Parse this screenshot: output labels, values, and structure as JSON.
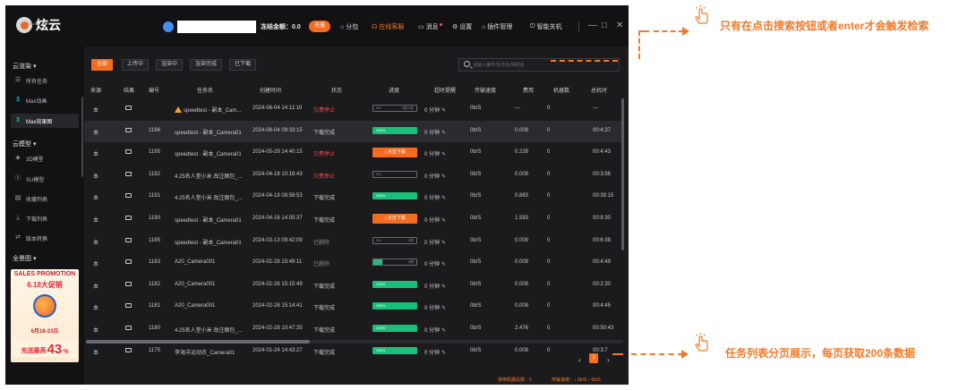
{
  "header": {
    "logo_text": "炫云",
    "logo_sub": "SHINE CLOUD",
    "frozen_amount": "冻结金额：0.0",
    "recharge_label": "充值",
    "nav": [
      "分包",
      "在线客服",
      "消息",
      "设置",
      "插件管理",
      "智能关机"
    ],
    "win_controls": [
      "—",
      "□",
      "✕"
    ]
  },
  "sidebar": {
    "groups": [
      {
        "label": "云渲染 ▾",
        "items": [
          {
            "icon": "list-icon",
            "glyph": "☰",
            "label": "所有任务"
          },
          {
            "icon": "max-icon",
            "glyph": "3",
            "label": "Max动画"
          },
          {
            "icon": "max-icon",
            "glyph": "3",
            "label": "Max效果图"
          }
        ]
      },
      {
        "label": "云模型 ▾",
        "items": [
          {
            "icon": "cube-icon",
            "glyph": "◈",
            "label": "3D模型"
          },
          {
            "icon": "sketchup-icon",
            "glyph": "ⓢ",
            "label": "SU模型"
          },
          {
            "icon": "collection-icon",
            "glyph": "▤",
            "label": "收藏列表"
          },
          {
            "icon": "download-icon",
            "glyph": "⤓",
            "label": "下载列表"
          },
          {
            "icon": "convert-icon",
            "glyph": "⇄",
            "label": "版本转换"
          }
        ]
      },
      {
        "label": "全景图 ▾",
        "items": []
      }
    ],
    "promo": {
      "top": "SALES PROMOTION",
      "title": "6.18大促销",
      "date": "6月18-23日",
      "bottom_small": "充送最高",
      "bottom_big": "43",
      "bottom_unit": "%"
    }
  },
  "tabs": [
    "全部",
    "上传中",
    "渲染中",
    "渲染完成",
    "已下载"
  ],
  "search": {
    "placeholder": "请输入编号/任务名/相机名"
  },
  "table": {
    "columns": [
      "来源",
      "结果",
      "编号",
      "任务名",
      "创建时间",
      "状态",
      "进度",
      "超时提醒",
      "传输速度",
      "费用",
      "机器数",
      "总机时"
    ],
    "rows": [
      {
        "src": "本",
        "id": "",
        "name": "speedtest - 副本_Cam...",
        "warn": true,
        "time": "2024-06-04 14:11:19",
        "status": "欠费停止",
        "status_color": "red",
        "progress": "0%",
        "progress_right": "0帧/1帧",
        "progress_fill": 0,
        "timeout": "0 分钟",
        "speed": "0b/S",
        "fee": "---",
        "machines": "0",
        "hours": "---"
      },
      {
        "src": "本",
        "id": "1196",
        "name": "speedtest - 副本_Camera01",
        "warn": false,
        "time": "2024-06-04 09:33:15",
        "status": "下载完成",
        "status_color": "normal",
        "progress": "100%",
        "progress_right": "",
        "progress_fill": 100,
        "timeout": "0 分钟",
        "speed": "0b/S",
        "fee": "0.009",
        "machines": "0",
        "hours": "00:4:37"
      },
      {
        "src": "本",
        "id": "1195",
        "name": "speedtest - 副本_Camera01",
        "warn": false,
        "time": "2024-05-29 14:40:15",
        "status": "欠费停止",
        "status_color": "red",
        "button": "点击下载",
        "timeout": "0 分钟",
        "speed": "0b/S",
        "fee": "0.239",
        "machines": "0",
        "hours": "00:4:43"
      },
      {
        "src": "本",
        "id": "1192",
        "name": "4.25名人堂小米 改注图包_...",
        "warn": false,
        "time": "2024-04-18 10:16:43",
        "status": "欠费停止",
        "status_color": "red",
        "progress": "0%",
        "progress_right": "",
        "progress_fill": 0,
        "timeout": "0 分钟",
        "speed": "0b/S",
        "fee": "0.009",
        "machines": "0",
        "hours": "00:3:56"
      },
      {
        "src": "本",
        "id": "1191",
        "name": "4.25名人堂小米 改注图包_...",
        "warn": false,
        "time": "2024-04-18 08:58:53",
        "status": "下载完成",
        "status_color": "normal",
        "progress": "100%",
        "progress_right": "",
        "progress_fill": 100,
        "timeout": "0 分钟",
        "speed": "0b/S",
        "fee": "0.883",
        "machines": "0",
        "hours": "00:39:15"
      },
      {
        "src": "本",
        "id": "1190",
        "name": "speedtest - 副本_Camera01",
        "warn": false,
        "time": "2024-04-16 14:05:37",
        "status": "下载完成",
        "status_color": "normal",
        "button": "点击下载",
        "timeout": "0 分钟",
        "speed": "0b/S",
        "fee": "1.593",
        "machines": "0",
        "hours": "00:8:30"
      },
      {
        "src": "本",
        "id": "1185",
        "name": "speedtest - 副本_Camera01",
        "warn": false,
        "time": "2024-03-13 09:42:09",
        "status": "已删除",
        "status_color": "gray",
        "progress": "0%",
        "progress_right": "0帧",
        "progress_fill": 0,
        "timeout": "0 分钟",
        "speed": "0b/S",
        "fee": "0.009",
        "machines": "0",
        "hours": "00:6:38"
      },
      {
        "src": "本",
        "id": "1183",
        "name": "A20_Camera001",
        "warn": false,
        "time": "2024-02-28 15:49:11",
        "status": "已删除",
        "status_color": "gray",
        "progress": "20%",
        "progress_right": "0帧",
        "progress_fill": 20,
        "timeout": "0 分钟",
        "speed": "0b/S",
        "fee": "0.009",
        "machines": "0",
        "hours": "00:4:49"
      },
      {
        "src": "本",
        "id": "1182",
        "name": "A20_Camera001",
        "warn": false,
        "time": "2024-02-28 15:15:49",
        "status": "下载完成",
        "status_color": "normal",
        "progress": "100%",
        "progress_right": "",
        "progress_fill": 100,
        "timeout": "0 分钟",
        "speed": "0b/S",
        "fee": "0.009",
        "machines": "0",
        "hours": "00:2:30"
      },
      {
        "src": "本",
        "id": "1181",
        "name": "A20_Camera001",
        "warn": false,
        "time": "2024-02-28 15:14:41",
        "status": "下载完成",
        "status_color": "normal",
        "progress": "100%",
        "progress_right": "",
        "progress_fill": 100,
        "timeout": "0 分钟",
        "speed": "0b/S",
        "fee": "0.009",
        "machines": "0",
        "hours": "00:4:45"
      },
      {
        "src": "本",
        "id": "1180",
        "name": "4.25名人堂小米 改注图包_...",
        "warn": false,
        "time": "2024-02-28 10:47:35",
        "status": "下载完成",
        "status_color": "normal",
        "progress": "100%",
        "progress_right": "",
        "progress_fill": 100,
        "timeout": "0 分钟",
        "speed": "0b/S",
        "fee": "2.476",
        "machines": "0",
        "hours": "00:50:43"
      },
      {
        "src": "本",
        "id": "1175",
        "name": "李海洋运动衣_Camera01",
        "warn": false,
        "time": "2024-01-24 14:43:27",
        "status": "下载完成",
        "status_color": "normal",
        "progress": "100%",
        "progress_right": "",
        "progress_fill": 100,
        "timeout": "0 分钟",
        "speed": "0b/S",
        "fee": "0.009",
        "machines": "0",
        "hours": "00:3:7"
      }
    ]
  },
  "pager": {
    "prev": "‹",
    "page": "1",
    "next": "›"
  },
  "status_bar": {
    "machines": "使用机器总数：0",
    "speed": "传输速度：↓ 0b/S ↑ 0b/S"
  },
  "annotations": {
    "search_note": "只有在点击搜索按钮或者enter才会触发检索",
    "pager_note": "任务列表分页展示，每页获取200条数据"
  },
  "colors": {
    "accent": "#f36c1f",
    "success": "#18c07a",
    "error": "#ef4a4a"
  }
}
